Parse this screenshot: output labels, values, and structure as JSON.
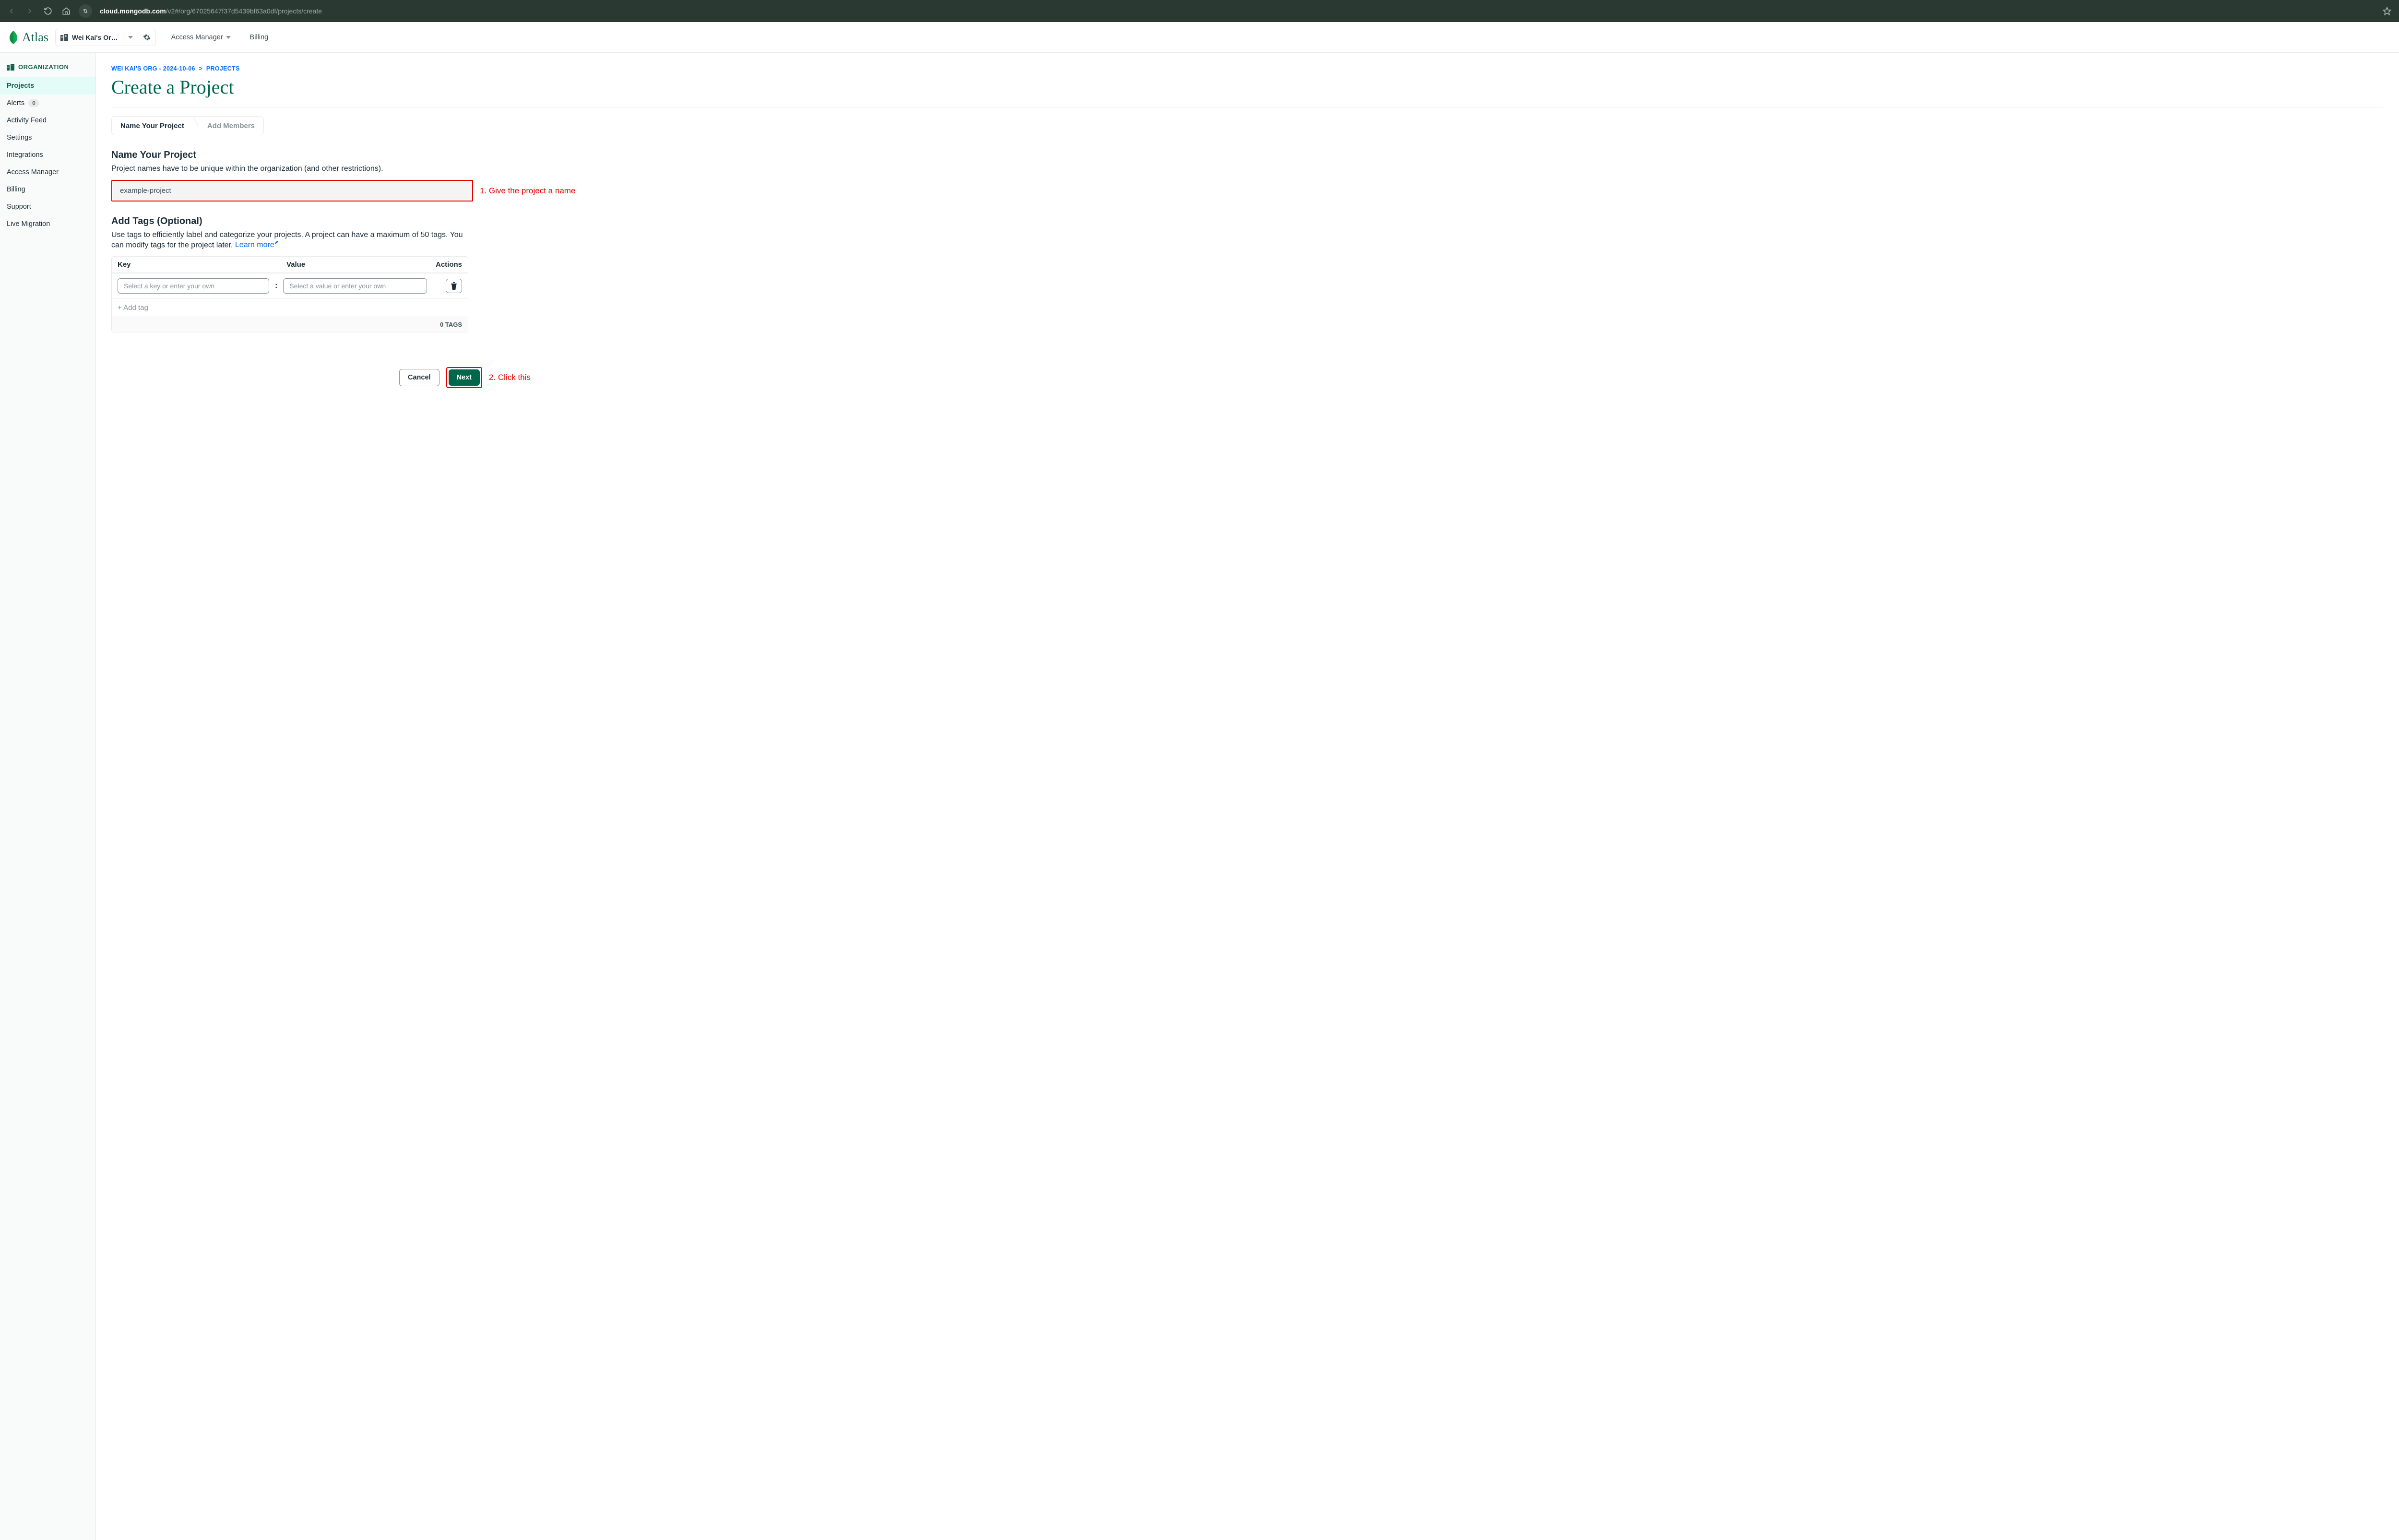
{
  "browser": {
    "url_host": "cloud.mongodb.com",
    "url_path": "/v2#/org/67025647f37d5439bf63a0df/projects/create"
  },
  "topnav": {
    "product": "Atlas",
    "org_picker": "Wei Kai's Or…",
    "access_manager": "Access Manager",
    "billing": "Billing"
  },
  "sidebar": {
    "header": "ORGANIZATION",
    "items": [
      {
        "label": "Projects",
        "active": true
      },
      {
        "label": "Alerts",
        "badge": "0"
      },
      {
        "label": "Activity Feed"
      },
      {
        "label": "Settings"
      },
      {
        "label": "Integrations"
      },
      {
        "label": "Access Manager"
      },
      {
        "label": "Billing"
      },
      {
        "label": "Support"
      },
      {
        "label": "Live Migration"
      }
    ]
  },
  "breadcrumb": {
    "org": "WEI KAI'S ORG - 2024-10-06",
    "sep": ">",
    "page": "PROJECTS"
  },
  "title": "Create a Project",
  "stepper": {
    "step1": "Name Your Project",
    "step2": "Add Members"
  },
  "name_section": {
    "heading": "Name Your Project",
    "desc": "Project names have to be unique within the organization (and other restrictions).",
    "value": "example-project"
  },
  "tags_section": {
    "heading": "Add Tags (Optional)",
    "desc_a": "Use tags to efficiently label and categorize your projects. A project can have a maximum of 50 tags. You can modify tags for the project later. ",
    "learn_more": "Learn more",
    "th_key": "Key",
    "th_value": "Value",
    "th_actions": "Actions",
    "key_placeholder": "Select a key or enter your own",
    "val_placeholder": "Select a value or enter your own",
    "add_tag": "+ Add tag",
    "footer": "0 TAGS"
  },
  "buttons": {
    "cancel": "Cancel",
    "next": "Next"
  },
  "annotations": {
    "a1": "1. Give the project a name",
    "a2": "2. Click this"
  }
}
